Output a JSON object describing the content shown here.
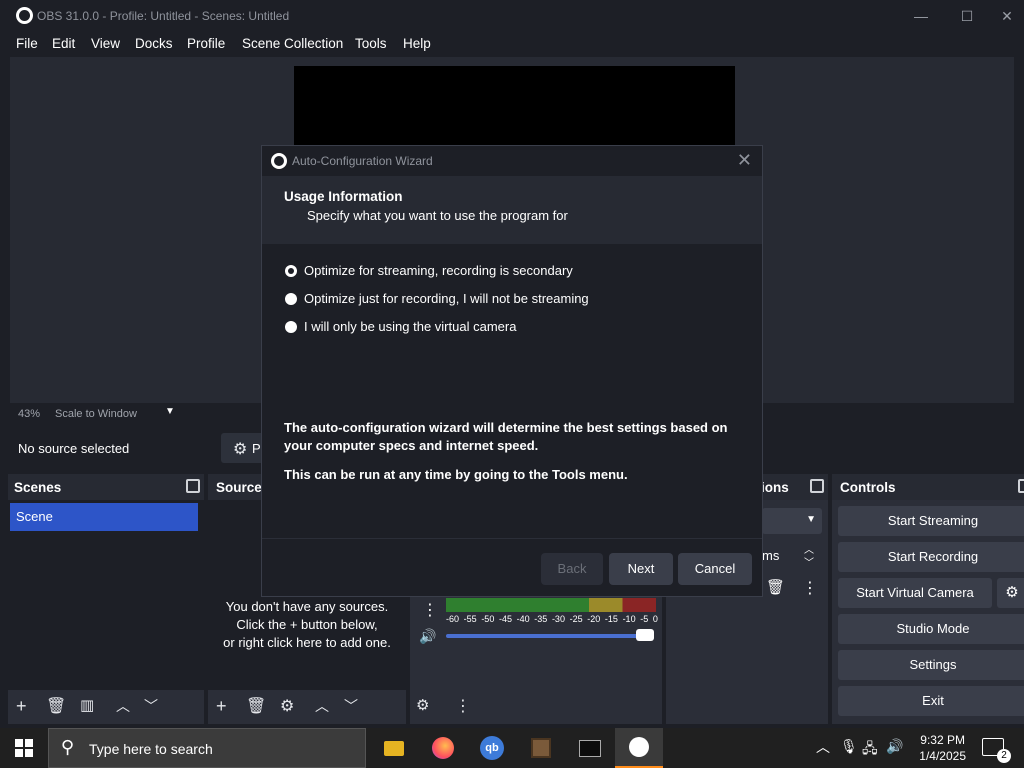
{
  "window": {
    "title": "OBS 31.0.0 - Profile: Untitled - Scenes: Untitled",
    "minimize": "—",
    "maximize": "☐",
    "close": "✕"
  },
  "menu": [
    "File",
    "Edit",
    "View",
    "Docks",
    "Profile",
    "Scene Collection",
    "Tools",
    "Help"
  ],
  "preview": {
    "zoom": "43%",
    "scale_mode": "Scale to Window",
    "no_source": "No source selected",
    "properties_label": "Pr"
  },
  "docks": {
    "scenes": {
      "title": "Scenes",
      "items": [
        "Scene"
      ]
    },
    "sources": {
      "title": "Sources",
      "empty_lines": [
        "You don't have any sources.",
        "Click the + button below,",
        "or right click here to add one."
      ]
    },
    "audio": {
      "ticks": [
        "-60",
        "-55",
        "-50",
        "-45",
        "-40",
        "-35",
        "-30",
        "-25",
        "-20",
        "-15",
        "-10",
        "-5",
        "0"
      ],
      "volume": 1.0
    },
    "transitions": {
      "title_fragment": "ions",
      "duration_fragment": "ms"
    },
    "controls": {
      "title": "Controls",
      "buttons": [
        "Start Streaming",
        "Start Recording",
        "Start Virtual Camera",
        "Studio Mode",
        "Settings",
        "Exit"
      ]
    }
  },
  "wizard": {
    "title": "Auto-Configuration Wizard",
    "heading": "Usage Information",
    "subheading": "Specify what you want to use the program for",
    "options": [
      {
        "label": "Optimize for streaming, recording is secondary",
        "checked": true
      },
      {
        "label": "Optimize just for recording, I will not be streaming",
        "checked": false
      },
      {
        "label": "I will only be using the virtual camera",
        "checked": false
      }
    ],
    "info1": "The auto-configuration wizard will determine the best settings based on your computer specs and internet speed.",
    "info2": "This can be run at any time by going to the Tools menu.",
    "buttons": {
      "back": "Back",
      "next": "Next",
      "cancel": "Cancel"
    }
  },
  "taskbar": {
    "search_placeholder": "Type here to search",
    "time": "9:32 PM",
    "date": "1/4/2025",
    "notifications": "2"
  },
  "colors": {
    "accent": "#2d55c8",
    "bg": "#1d1f26",
    "panel": "#2b2e38"
  }
}
